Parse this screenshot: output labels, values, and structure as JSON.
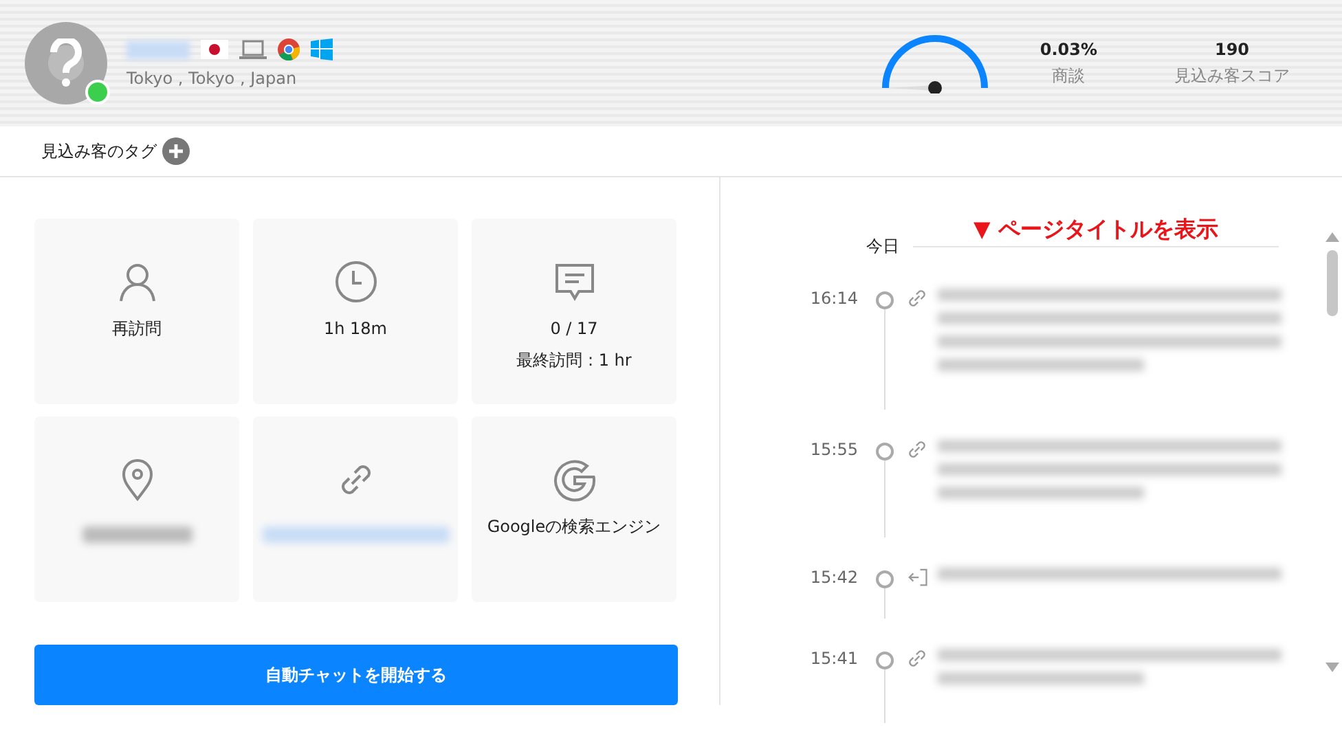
{
  "visitor": {
    "online": true,
    "location": "Tokyo , Tokyo , Japan"
  },
  "stats": [
    {
      "value": "0.03%",
      "label": "商談"
    },
    {
      "value": "190",
      "label": "見込み客スコア"
    }
  ],
  "tags": {
    "label": "見込み客のタグ"
  },
  "cards": [
    {
      "kind": "person",
      "lines": [
        "再訪問"
      ]
    },
    {
      "kind": "clock",
      "lines": [
        "1h 18m"
      ]
    },
    {
      "kind": "chat",
      "lines": [
        "0 / 17",
        "最終訪問 : 1 hr"
      ]
    },
    {
      "kind": "pin"
    },
    {
      "kind": "link"
    },
    {
      "kind": "google",
      "lines": [
        "Googleの検索エンジン"
      ]
    }
  ],
  "start_button": "自動チャットを開始する",
  "timeline": {
    "day": "今日",
    "annotation": "▼ ページタイトルを表示",
    "events": [
      {
        "time": "16:14",
        "kind": "link"
      },
      {
        "time": "15:55",
        "kind": "link"
      },
      {
        "time": "15:42",
        "kind": "exit"
      },
      {
        "time": "15:41",
        "kind": "link"
      }
    ]
  }
}
